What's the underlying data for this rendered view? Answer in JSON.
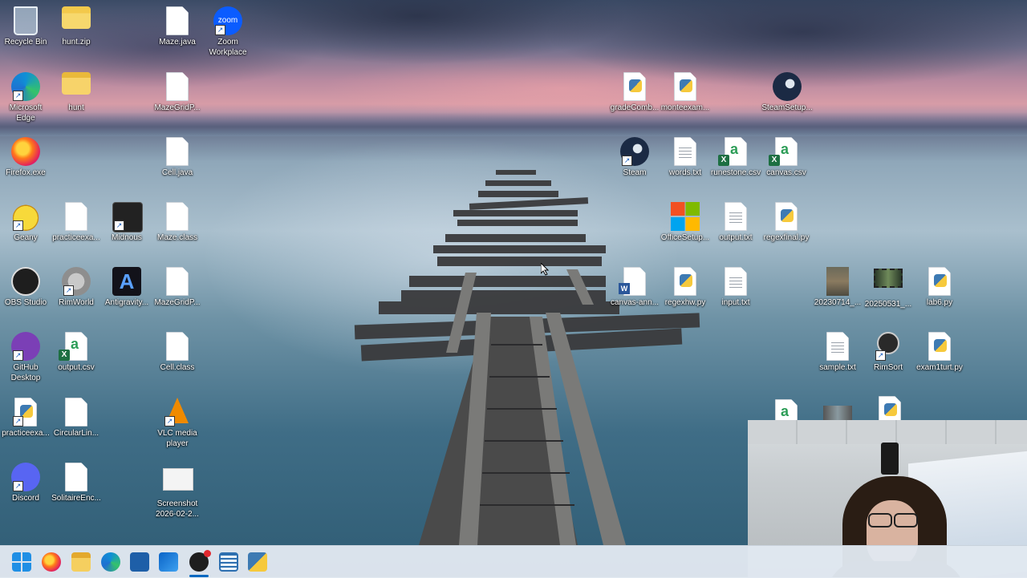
{
  "desktop": {
    "icons": [
      {
        "id": "recycle-bin",
        "label": "Recycle Bin"
      },
      {
        "id": "hunt-zip",
        "label": "hunt.zip"
      },
      {
        "id": "maze-java",
        "label": "Maze.java"
      },
      {
        "id": "zoom",
        "label": "Zoom Workplace",
        "badge": "zoom"
      },
      {
        "id": "edge",
        "label": "Microsoft Edge"
      },
      {
        "id": "hunt-folder",
        "label": "hunt"
      },
      {
        "id": "mazegridp-1",
        "label": "MazeGridP..."
      },
      {
        "id": "gradecomb",
        "label": "gradeComb..."
      },
      {
        "id": "monteexam",
        "label": "monteexam..."
      },
      {
        "id": "steamsetup",
        "label": "SteamSetup..."
      },
      {
        "id": "firefox",
        "label": "Firefox.exe"
      },
      {
        "id": "cell-java",
        "label": "Cell.java"
      },
      {
        "id": "steam",
        "label": "Steam"
      },
      {
        "id": "words-txt",
        "label": "words.txt"
      },
      {
        "id": "runestone-csv",
        "label": "runestone.csv"
      },
      {
        "id": "canvas-csv",
        "label": "canvas.csv"
      },
      {
        "id": "geany",
        "label": "Geany"
      },
      {
        "id": "practiceexa-1",
        "label": "practiceexa..."
      },
      {
        "id": "midnous",
        "label": "Midnous"
      },
      {
        "id": "maze-class",
        "label": "Maze.class"
      },
      {
        "id": "officesetup",
        "label": "OfficeSetup..."
      },
      {
        "id": "output-txt",
        "label": "output.txt"
      },
      {
        "id": "regexfinal",
        "label": "regexfinal.py"
      },
      {
        "id": "obs",
        "label": "OBS Studio"
      },
      {
        "id": "rimworld",
        "label": "RimWorld"
      },
      {
        "id": "antigravity",
        "label": "Antigravity..."
      },
      {
        "id": "mazegridp-2",
        "label": "MazeGridP..."
      },
      {
        "id": "canvas-ann",
        "label": "canvas-ann..."
      },
      {
        "id": "regexhw",
        "label": "regexhw.py"
      },
      {
        "id": "input-txt",
        "label": "input.txt"
      },
      {
        "id": "img-20230714",
        "label": "20230714_..."
      },
      {
        "id": "img-20250531",
        "label": "20250531_..."
      },
      {
        "id": "lab6",
        "label": "lab6.py"
      },
      {
        "id": "github",
        "label": "GitHub Desktop"
      },
      {
        "id": "output-csv",
        "label": "output.csv"
      },
      {
        "id": "cell-class",
        "label": "Cell.class"
      },
      {
        "id": "sample-txt",
        "label": "sample.txt"
      },
      {
        "id": "rimsort",
        "label": "RimSort"
      },
      {
        "id": "exam1turt",
        "label": "exam1turt.py"
      },
      {
        "id": "practiceexa-2",
        "label": "practiceexa..."
      },
      {
        "id": "circularlin",
        "label": "CircularLin..."
      },
      {
        "id": "vlc",
        "label": "VLC media player"
      },
      {
        "id": "discord",
        "label": "Discord"
      },
      {
        "id": "solitaireenc",
        "label": "SolitaireEnc..."
      },
      {
        "id": "screenshot",
        "label": "Screenshot 2026-02-2..."
      }
    ]
  },
  "taskbar": {
    "items": [
      "start",
      "firefox",
      "file-explorer",
      "edge",
      "store",
      "outlook",
      "obs",
      "notepad",
      "python"
    ]
  },
  "colors": {
    "taskbar": "#e1e8f0",
    "label": "#ffffff",
    "excel": "#1d6f42",
    "python_blue": "#3d7ab3",
    "python_yellow": "#f6c93c"
  }
}
